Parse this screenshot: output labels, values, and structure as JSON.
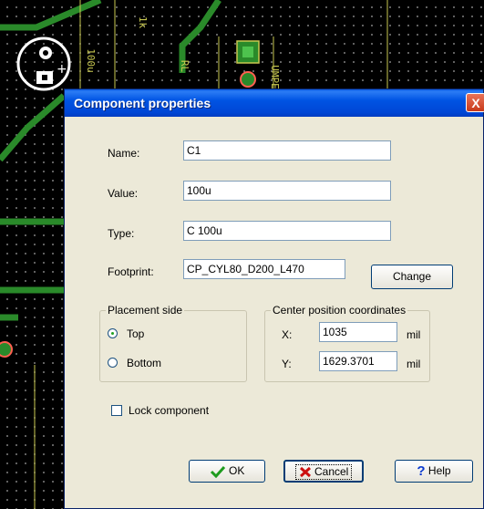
{
  "pcb": {
    "component_label_1": "100u",
    "component_label_2": "RL",
    "component_label_3": "UMPE",
    "component_label_4": "1k",
    "colors": {
      "trace": "#2a8a2a",
      "silkscreen": "#c8c850",
      "pad": "#ffffff"
    }
  },
  "dialog": {
    "title": "Component properties",
    "close_label": "X",
    "name_label": "Name:",
    "name_value": "C1",
    "value_label": "Value:",
    "value_value": "100u",
    "type_label": "Type:",
    "type_value": "C 100u",
    "footprint_label": "Footprint:",
    "footprint_value": "CP_CYL80_D200_L470",
    "change_button": "Change",
    "placement_title": "Placement side",
    "placement_top": "Top",
    "placement_bottom": "Bottom",
    "placement_selected": "Top",
    "coords_title": "Center position coordinates",
    "x_label": "X:",
    "x_value": "1035",
    "x_unit": "mil",
    "y_label": "Y:",
    "y_value": "1629.3701",
    "y_unit": "mil",
    "lock_label": "Lock component",
    "lock_checked": false,
    "ok_button": "OK",
    "cancel_button": "Cancel",
    "help_button": "Help"
  }
}
